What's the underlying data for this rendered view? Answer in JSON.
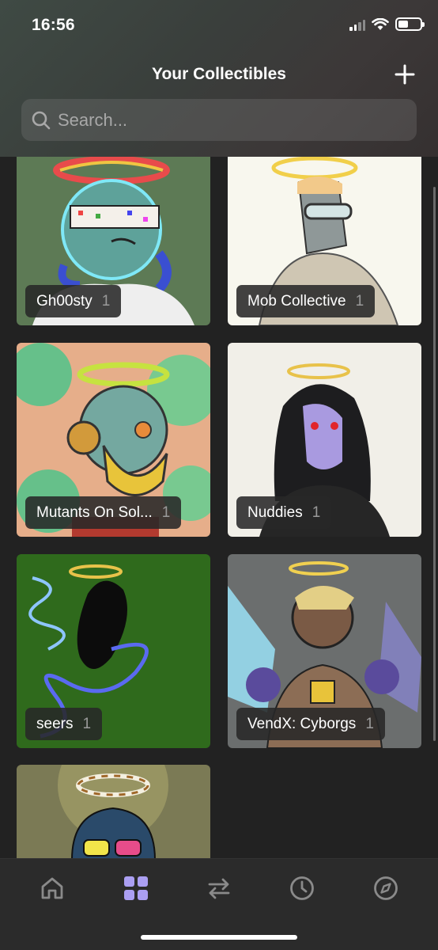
{
  "status_bar": {
    "time": "16:56"
  },
  "header": {
    "title": "Your Collectibles",
    "add_icon": "plus-icon"
  },
  "search": {
    "placeholder": "Search...",
    "value": "",
    "icon": "search-icon"
  },
  "collections": [
    {
      "name": "Gh00sty",
      "count": "1"
    },
    {
      "name": "Mob Collective",
      "count": "1"
    },
    {
      "name": "Mutants On Sol...",
      "count": "1"
    },
    {
      "name": "Nuddies",
      "count": "1"
    },
    {
      "name": "seers",
      "count": "1"
    },
    {
      "name": "VendX: Cyborgs",
      "count": "1"
    },
    {
      "name": "",
      "count": ""
    }
  ],
  "tabbar": {
    "active": "collectibles",
    "tabs": [
      {
        "id": "home",
        "icon": "home-icon"
      },
      {
        "id": "collectibles",
        "icon": "grid-icon"
      },
      {
        "id": "swap",
        "icon": "swap-arrows-icon"
      },
      {
        "id": "activity",
        "icon": "clock-icon"
      },
      {
        "id": "explore",
        "icon": "compass-icon"
      }
    ]
  },
  "colors": {
    "accent": "#ab9ff2",
    "inactive_icon": "#8a8a8a",
    "background": "#222222"
  }
}
